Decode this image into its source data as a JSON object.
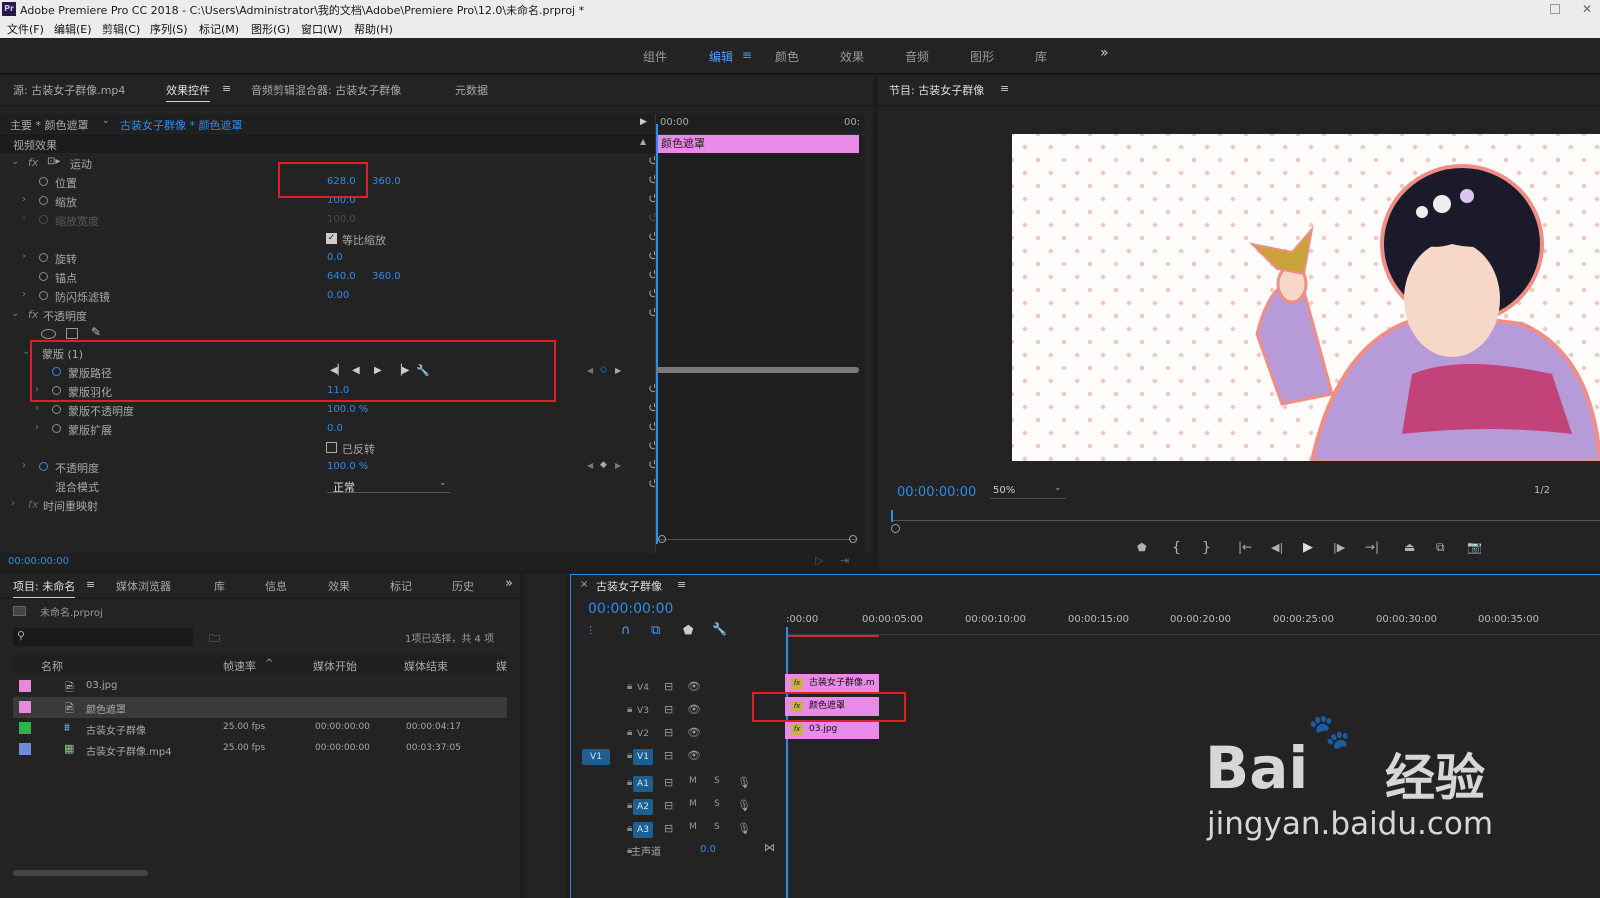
{
  "titlebar": {
    "title": "Adobe Premiere Pro CC 2018 - C:\\Users\\Administrator\\我的文档\\Adobe\\Premiere Pro\\12.0\\未命名.prproj *"
  },
  "menu": [
    "文件(F)",
    "编辑(E)",
    "剪辑(C)",
    "序列(S)",
    "标记(M)",
    "图形(G)",
    "窗口(W)",
    "帮助(H)"
  ],
  "workspaces": [
    "组件",
    "编辑",
    "颜色",
    "效果",
    "音频",
    "图形",
    "库"
  ],
  "workspace_more": "»",
  "source_panel": {
    "tabs": [
      "源: 古装女子群像.mp4",
      "效果控件",
      "音频剪辑混合器: 古装女子群像",
      "元数据"
    ],
    "master": "主要 * 颜色遮罩",
    "clip": "古装女子群像 * 颜色遮罩",
    "video_effects": "视频效果",
    "motion": "运动",
    "position_label": "位置",
    "position_x": "628.0",
    "position_y": "360.0",
    "scale_label": "缩放",
    "scale_val": "100.0",
    "scale_width_label": "缩放宽度",
    "scale_width_val": "100.0",
    "uniform_scale": "等比缩放",
    "rotation_label": "旋转",
    "rotation_val": "0.0",
    "anchor_label": "锚点",
    "anchor_x": "640.0",
    "anchor_y": "360.0",
    "antiflicker_label": "防闪烁滤镜",
    "antiflicker_val": "0.00",
    "opacity_group": "不透明度",
    "mask_label": "蒙版 (1)",
    "mask_path_label": "蒙版路径",
    "mask_feather_label": "蒙版羽化",
    "mask_feather_val": "11.0",
    "mask_opacity_label": "蒙版不透明度",
    "mask_opacity_val": "100.0 %",
    "mask_expansion_label": "蒙版扩展",
    "mask_expansion_val": "0.0",
    "inverted_label": "已反转",
    "opacity_label": "不透明度",
    "opacity_val": "100.0 %",
    "blend_label": "混合模式",
    "blend_val": "正常",
    "time_remap": "时间重映射",
    "timecode": "00:00:00:00",
    "mini_timeline": {
      "start": "00:00",
      "end": "00:",
      "clip": "颜色遮罩"
    }
  },
  "program": {
    "title": "节目: 古装女子群像",
    "timecode": "00:00:00:00",
    "zoom": "50%",
    "res": "1/2"
  },
  "project": {
    "tabs": [
      "项目: 未命名",
      "媒体浏览器",
      "库",
      "信息",
      "效果",
      "标记",
      "历史"
    ],
    "file": "未命名.prproj",
    "selection": "1项已选择，共 4 项",
    "columns": [
      "名称",
      "帧速率",
      "媒体开始",
      "媒体结束",
      "媒"
    ],
    "rows": [
      {
        "color": "#e888d8",
        "name": "03.jpg",
        "fps": "",
        "start": "",
        "end": ""
      },
      {
        "color": "#e888d8",
        "name": "颜色遮罩",
        "fps": "",
        "start": "",
        "end": ""
      },
      {
        "color": "#2db548",
        "name": "古装女子群像",
        "fps": "25.00 fps",
        "start": "00:00:00:00",
        "end": "00:00:04:17"
      },
      {
        "color": "#6a8ed8",
        "name": "古装女子群像.mp4",
        "fps": "25.00 fps",
        "start": "00:00:00:00",
        "end": "00:03:37:05"
      }
    ]
  },
  "timeline": {
    "title": "古装女子群像",
    "timecode": "00:00:00:00",
    "ruler": [
      ":00:00",
      "00:00:05:00",
      "00:00:10:00",
      "00:00:15:00",
      "00:00:20:00",
      "00:00:25:00",
      "00:00:30:00",
      "00:00:35:00"
    ],
    "tracks": [
      {
        "name": "V4",
        "clip": "古装女子群像.m"
      },
      {
        "name": "V3",
        "clip": "颜色遮罩"
      },
      {
        "name": "V2",
        "clip": "03.jpg"
      },
      {
        "name": "V1",
        "clip": ""
      },
      {
        "name": "A1"
      },
      {
        "name": "A2"
      },
      {
        "name": "A3"
      }
    ],
    "src_v1": "V1",
    "m": "M",
    "s": "S",
    "master_label": "主声道",
    "master_val": "0.0"
  },
  "watermark": {
    "line1": "Bai",
    "line2": "经验",
    "url": "jingyan.baidu.com"
  }
}
